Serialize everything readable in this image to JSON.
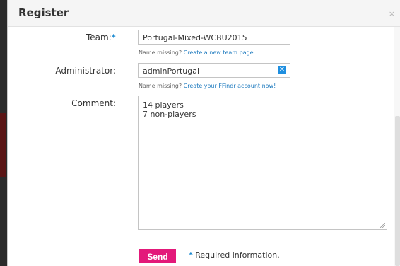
{
  "dialog": {
    "title": "Register",
    "close_glyph": "×"
  },
  "form": {
    "required_marker": "*",
    "team": {
      "label": "Team:",
      "value": "Portugal-Mixed-WCBU2015",
      "hint_prefix": "Name missing?",
      "hint_link": "Create a new team page."
    },
    "administrator": {
      "label": "Administrator:",
      "value": "adminPortugal",
      "clear_glyph": "✕",
      "hint_prefix": "Name missing?",
      "hint_link": "Create your FFindr account now!"
    },
    "comment": {
      "label": "Comment:",
      "lines": [
        "14 players",
        "7 non-players"
      ]
    }
  },
  "footer": {
    "send_label": "Send",
    "required_marker": "*",
    "required_text": "Required information."
  },
  "colors": {
    "accent_pink": "#e3197a",
    "link_blue": "#1f7bbf",
    "required_blue": "#1a8ad1"
  },
  "icons": {
    "close": "close-icon",
    "clear": "clear-icon",
    "resize": "resize-grip-icon"
  }
}
